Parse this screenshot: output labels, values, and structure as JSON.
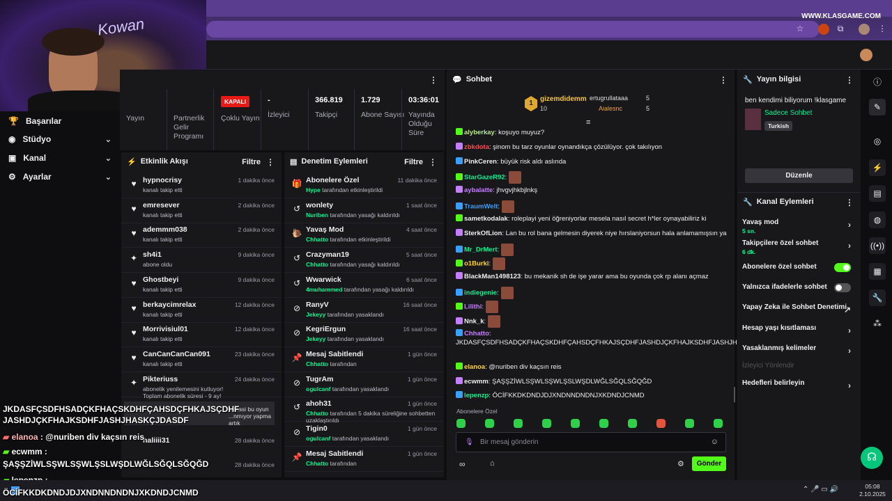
{
  "browser": {
    "watermark": "WWW.KLASGAME.COM"
  },
  "webcam": {
    "sign": "Kowan"
  },
  "left_nav": {
    "items": [
      {
        "label": "Başarılar",
        "has_chevron": false
      },
      {
        "label": "Stüdyo",
        "has_chevron": true
      },
      {
        "label": "Kanal",
        "has_chevron": true
      },
      {
        "label": "Ayarlar",
        "has_chevron": true
      }
    ]
  },
  "stats": {
    "yayin": "Yayın",
    "partner": "Partnerlik Gelir Programı",
    "badge": "KAPALI",
    "coklu": "Çoklu Yayın",
    "izleyici_value": "-",
    "izleyici": "İzleyici",
    "takipci_value": "366.819",
    "takipci": "Takipçi",
    "abone_value": "1.729",
    "abone": "Abone Sayısı",
    "sure_value": "03:36:01",
    "sure": "Yayında Olduğu Süre"
  },
  "activity": {
    "title": "Etkinlik Akışı",
    "filter": "Filtre",
    "items": [
      {
        "name": "hypnocrisy",
        "sub": "kanalı takip etti",
        "time": "1 dakika önce",
        "icon": "heart-icon"
      },
      {
        "name": "emresever",
        "sub": "kanalı takip etti",
        "time": "2 dakika önce",
        "icon": "heart-icon"
      },
      {
        "name": "ademmm038",
        "sub": "kanalı takip etti",
        "time": "2 dakika önce",
        "icon": "heart-icon"
      },
      {
        "name": "sh4i1",
        "sub": "abone oldu",
        "time": "9 dakika önce",
        "icon": "star-icon"
      },
      {
        "name": "Ghostbeyi",
        "sub": "kanalı takip etti",
        "time": "9 dakika önce",
        "icon": "heart-icon"
      },
      {
        "name": "berkaycimrelax",
        "sub": "kanalı takip etti",
        "time": "12 dakika önce",
        "icon": "heart-icon"
      },
      {
        "name": "Morrivisiul01",
        "sub": "kanalı takip etti",
        "time": "12 dakika önce",
        "icon": "heart-icon"
      },
      {
        "name": "CanCanCanCan091",
        "sub": "kanalı takip etti",
        "time": "23 dakika önce",
        "icon": "heart-icon"
      },
      {
        "name": "Pikteriuss",
        "sub": "abonelik yenilemesini kutluyor! Toplam abonelik süresi - 9 ay!",
        "time": "24 dakika önce",
        "icon": "star-icon"
      }
    ],
    "highlight_msg": "...masi bu oyun ...nmıyor yapma artık",
    "bottom": [
      {
        "name": "haliiii31",
        "time": "28 dakika önce"
      },
      {
        "name": "",
        "time": "28 dakika önce"
      }
    ]
  },
  "moderation": {
    "title": "Denetim Eylemleri",
    "filter": "Filtre",
    "items": [
      {
        "name": "Abonelere Özel",
        "actor": "Hype",
        "sub": " tarafından etkinleştirildi",
        "time": "11 dakika önce",
        "icon": "gift-icon"
      },
      {
        "name": "wonlety",
        "actor": "Nuriben",
        "sub": " tarafından yasağı kaldırıldı",
        "time": "1 saat önce",
        "icon": "undo-icon"
      },
      {
        "name": "Yavaş Mod",
        "actor": "Chhatto",
        "sub": " tarafından etkinleştirildi",
        "time": "4 saat önce",
        "icon": "snail-icon"
      },
      {
        "name": "Crazyman19",
        "actor": "Chhatto",
        "sub": " tarafından yasağı kaldırıldı",
        "time": "5 saat önce",
        "icon": "undo-icon"
      },
      {
        "name": "Wwarwick",
        "actor": "4muhammed",
        "sub": " tarafından yasağı kaldırıldı",
        "time": "6 saat önce",
        "icon": "undo-icon"
      },
      {
        "name": "RanyV",
        "actor": "Jekeyy",
        "sub": " tarafından yasaklandı",
        "time": "16 saat önce",
        "icon": "ban-icon"
      },
      {
        "name": "KegriErgun",
        "actor": "Jekeyy",
        "sub": " tarafından yasaklandı",
        "time": "16 saat önce",
        "icon": "ban-icon"
      },
      {
        "name": "Mesaj Sabitlendi",
        "actor": "Chhatto",
        "sub": " tarafından",
        "time": "1 gün önce",
        "icon": "pin-icon"
      },
      {
        "name": "TugrAm",
        "actor": "ogulcanf",
        "sub": " tarafından yasaklandı",
        "time": "1 gün önce",
        "icon": "ban-icon"
      },
      {
        "name": "ahoh31",
        "actor": "Chhatto",
        "sub": " tarafından 5 dakika süreliğine sohbetten uzaklaştırıldı",
        "time": "1 gün önce",
        "icon": "undo-icon"
      },
      {
        "name": "Tigin0",
        "actor": "ogulcanf",
        "sub": " tarafından yasaklandı",
        "time": "1 gün önce",
        "icon": "ban-icon"
      },
      {
        "name": "Mesaj Sabitlendi",
        "actor": "Chhatto",
        "sub": " tarafından",
        "time": "1 gün önce",
        "icon": "pin-icon"
      }
    ]
  },
  "chat": {
    "title": "Sohbet",
    "top_gifters": [
      {
        "rank": "1",
        "name": "gizemdidemm",
        "count": "10"
      },
      {
        "rank": "",
        "name": "ertugrullataaa",
        "count": "5"
      },
      {
        "rank": "",
        "name": "Aialesnc",
        "count": "5"
      }
    ],
    "messages": [
      {
        "user": "alyberkay",
        "color": "#b8e986",
        "text": ": koşuyo muyuz?"
      },
      {
        "user": "zbkdota",
        "color": "#ff4a4a",
        "text": ": şinom bu tarz oyunlar oynandıkça çözülüyor. çok takılıyon"
      },
      {
        "user": "PinkCeren",
        "color": "#efeff1",
        "text": ": büyük risk aldı aslında"
      },
      {
        "user": "StarGazeR92",
        "color": "#00f593",
        "text": ":"
      },
      {
        "user": "aybalatte",
        "color": "#c77dff",
        "text": ": jhvgvjhkbjlnkş"
      },
      {
        "user": "TraumWelt",
        "color": "#3aa0ff",
        "text": ":"
      },
      {
        "user": "sametkodalak",
        "color": "#efeff1",
        "text": ": roleplayi yeni öğreniyorlar mesela nasıl secret h*ler oynayabiliriz ki"
      },
      {
        "user": "SterkOfLion",
        "color": "#efeff1",
        "text": ": Lan bu rol bana gelmesin diyerek niye hırslaniyorsun hala anlamamışsın ya"
      },
      {
        "user": "Mr_DrMert",
        "color": "#00f593",
        "text": ":"
      },
      {
        "user": "o1Burki",
        "color": "#ffd43b",
        "text": ":"
      },
      {
        "user": "BlackMan1498123",
        "color": "#efeff1",
        "text": ": bu mekanik sh de işe yarar ama bu oyunda çok rp alanı açmaz"
      },
      {
        "user": "indiegenie",
        "color": "#00f593",
        "text": ":"
      },
      {
        "user": "Lilithi",
        "color": "#c77dff",
        "text": ":"
      },
      {
        "user": "Nnk_k",
        "color": "#efeff1",
        "text": ":"
      },
      {
        "user": "Chhatto",
        "color": "#c77dff",
        "text": ": JKDASFÇSDFHSADÇKFHAÇSKDHFÇAHSDÇFHKAJSÇDHFJASHDJÇKFHAJKSDHFJASHJHASKÇJDASDF"
      },
      {
        "user": "elanoa",
        "color": "#ffd43b",
        "text": ": @nuriben div kaçsın reis"
      },
      {
        "user": "ecwmm",
        "color": "#efeff1",
        "text": ": ŞAŞŞZİWLSŞWLSŞWLŞSLWŞDLWĞLSĞQLSĞQĞD"
      },
      {
        "user": "lepenzp",
        "color": "#00f593",
        "text": ": ÖCİFKKDKDNDJDJXNDNNDNDNJXKDNDJCNMD"
      }
    ],
    "sub_only_label": "Abonelere Özel",
    "input_placeholder": "Bir mesaj gönderin",
    "send": "Gönder"
  },
  "stream_info": {
    "title": "Yayın bilgisi",
    "stream_title": "ben kendimi biliyorum !klasgame",
    "category": "Sadece Sohbet",
    "tag": "Turkish",
    "edit": "Düzenle"
  },
  "channel_actions": {
    "title": "Kanal Eylemleri",
    "items": [
      {
        "label": "Yavaş mod",
        "sub": "5 sn.",
        "type": "chevron"
      },
      {
        "label": "Takipçilere özel sohbet",
        "sub": "6 dk.",
        "type": "chevron"
      },
      {
        "label": "Abonelere özel sohbet",
        "sub": "",
        "type": "toggle-on"
      },
      {
        "label": "Yalnızca ifadelerle sohbet",
        "sub": "",
        "type": "toggle-off"
      },
      {
        "label": "Yapay Zeka ile Sohbet Denetimi",
        "sub": "",
        "type": "external"
      },
      {
        "label": "Hesap yaşı kısıtlaması",
        "sub": "",
        "type": "chevron"
      },
      {
        "label": "Yasaklanmış kelimeler",
        "sub": "",
        "type": "chevron"
      },
      {
        "label": "İzleyici Yönlendir",
        "sub": "",
        "type": "disabled"
      },
      {
        "label": "Hedefleri belirleyin",
        "sub": "",
        "type": "chevron"
      }
    ]
  },
  "overlay_chat": [
    {
      "user": "",
      "text": "JKDASFÇSDFHSADÇKFHAÇSKDHFÇAHSDÇFHKAJSÇDHF JASHDJÇKFHAJKSDHFJASHJHASKÇJDASDF"
    },
    {
      "user": "elanoa",
      "text": " : @nuriben div kaçsın reis"
    },
    {
      "user": "ecwmm",
      "text": " :"
    },
    {
      "user": "",
      "text": "ŞAŞŞZİWLSŞWLSŞWLŞSLWŞDLWĞLSĞQLSĞQĞD"
    },
    {
      "user": "lepenzp",
      "text": " :"
    },
    {
      "user": "",
      "text": "ÖCİFKKDKDNDJDJXNDNNDNDNJXKDNDJCNMD"
    }
  ],
  "taskbar": {
    "time": "05:08",
    "date": "2.10.2025"
  },
  "colors": {
    "accent": "#53fc18",
    "kick_green": "#00f593",
    "badge_red": "#e91916"
  }
}
